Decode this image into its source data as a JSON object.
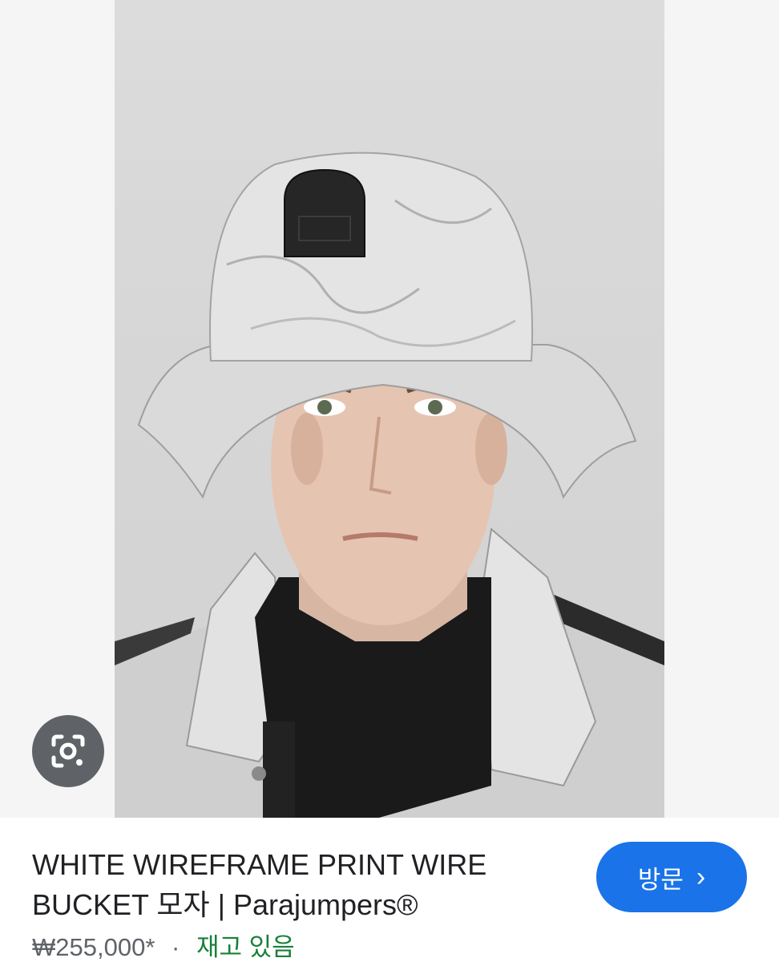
{
  "product": {
    "title": "WHITE WIREFRAME PRINT WIRE BUCKET 모자 | Parajumpers®",
    "price": "₩255,000*",
    "separator": "·",
    "stock": "재고 있음"
  },
  "actions": {
    "visit_label": "방문",
    "visit_chevron": "›",
    "lens_icon": "lens-camera-icon"
  },
  "colors": {
    "visit_button": "#1a73e8",
    "stock_text": "#188038",
    "lens_button": "#5f6368"
  }
}
